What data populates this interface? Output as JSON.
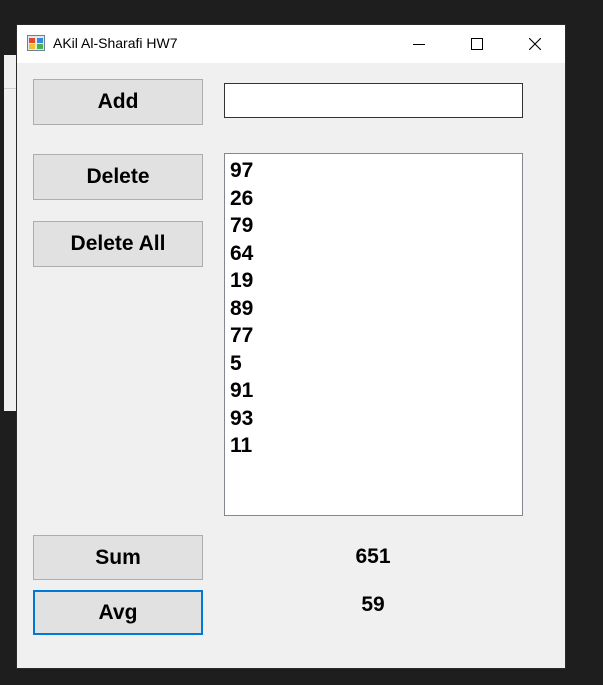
{
  "window": {
    "title": "AKil Al-Sharafi HW7",
    "icon": "app-form-icon",
    "caption_buttons": [
      "minimize-icon",
      "maximize-icon",
      "close-icon"
    ]
  },
  "buttons": {
    "add": "Add",
    "delete": "Delete",
    "delete_all": "Delete All",
    "sum": "Sum",
    "avg": "Avg"
  },
  "input": {
    "value": "",
    "placeholder": ""
  },
  "list": {
    "items": [
      "97",
      "26",
      "79",
      "64",
      "19",
      "89",
      "77",
      "5",
      "91",
      "93",
      "11"
    ]
  },
  "results": {
    "sum": "651",
    "avg": "59"
  },
  "colors": {
    "window_bg": "#f0f0f0",
    "button_bg": "#e1e1e1",
    "focus_border": "#0078d7",
    "desktop_bg": "#1e1e1e"
  }
}
